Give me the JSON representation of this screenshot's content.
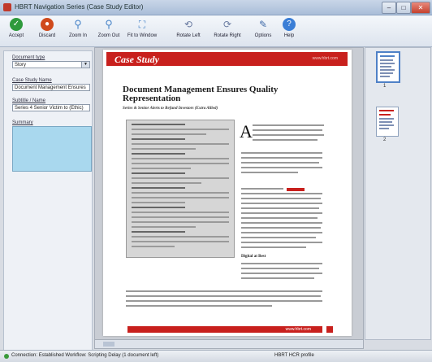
{
  "window": {
    "title": "HBRT Navigation Series (Case Study Editor)",
    "minimize_label": "–",
    "maximize_label": "□",
    "close_label": "✕"
  },
  "toolbar": {
    "buttons": [
      {
        "label": "Accept",
        "icon": "accept-icon",
        "color": "#2e9a3c"
      },
      {
        "label": "Discard",
        "icon": "discard-icon",
        "color": "#d04a1c"
      },
      {
        "label": "Zoom In",
        "icon": "zoom-in-icon",
        "color": "#4b86c9"
      },
      {
        "label": "Zoom Out",
        "icon": "zoom-out-icon",
        "color": "#4b86c9"
      },
      {
        "label": "Fit to Window",
        "icon": "fit-to-window-icon",
        "color": "#4b86c9"
      },
      {
        "label": "Rotate Left",
        "icon": "rotate-left-icon",
        "color": "#6c7da3"
      },
      {
        "label": "Rotate Right",
        "icon": "rotate-right-icon",
        "color": "#6c7da3"
      },
      {
        "label": "Options",
        "icon": "options-icon",
        "color": "#3f6aa8"
      },
      {
        "label": "Help",
        "icon": "help-icon",
        "color": "#3b7ed6"
      }
    ]
  },
  "sidebar": {
    "document_type_label": "Document type",
    "document_type_value": "Story",
    "case_study_name_label": "Case Study Name",
    "case_study_name_value": "Document Management Ensures",
    "subtitle_label": "Subtitle / Name",
    "subtitle_value": "Series 4 Senior Victim to (Ethic)",
    "summary_label": "Summary",
    "summary_value": ""
  },
  "document": {
    "banner_title": "Case Study",
    "banner_tag": "www.hbrt.com",
    "title": "Document Management Ensures Quality Representation",
    "subtitle": "Series & Senior Alerts to Refund Investors (Extra Allied)",
    "dropcap": "A",
    "section_heading": "Digital at Best",
    "footer_url": "www.hbrt.com"
  },
  "thumbnails": [
    {
      "number": "1",
      "selected": true
    },
    {
      "number": "2",
      "selected": false
    }
  ],
  "statusbar": {
    "connection": "Connection: Established   Workflow: Scripting Delay (1 document left)",
    "right": "HBRT HCR profile"
  },
  "colors": {
    "accent_red": "#c8201d",
    "summary_fill": "#a9d8ee",
    "selection_blue": "#4f81c7"
  }
}
